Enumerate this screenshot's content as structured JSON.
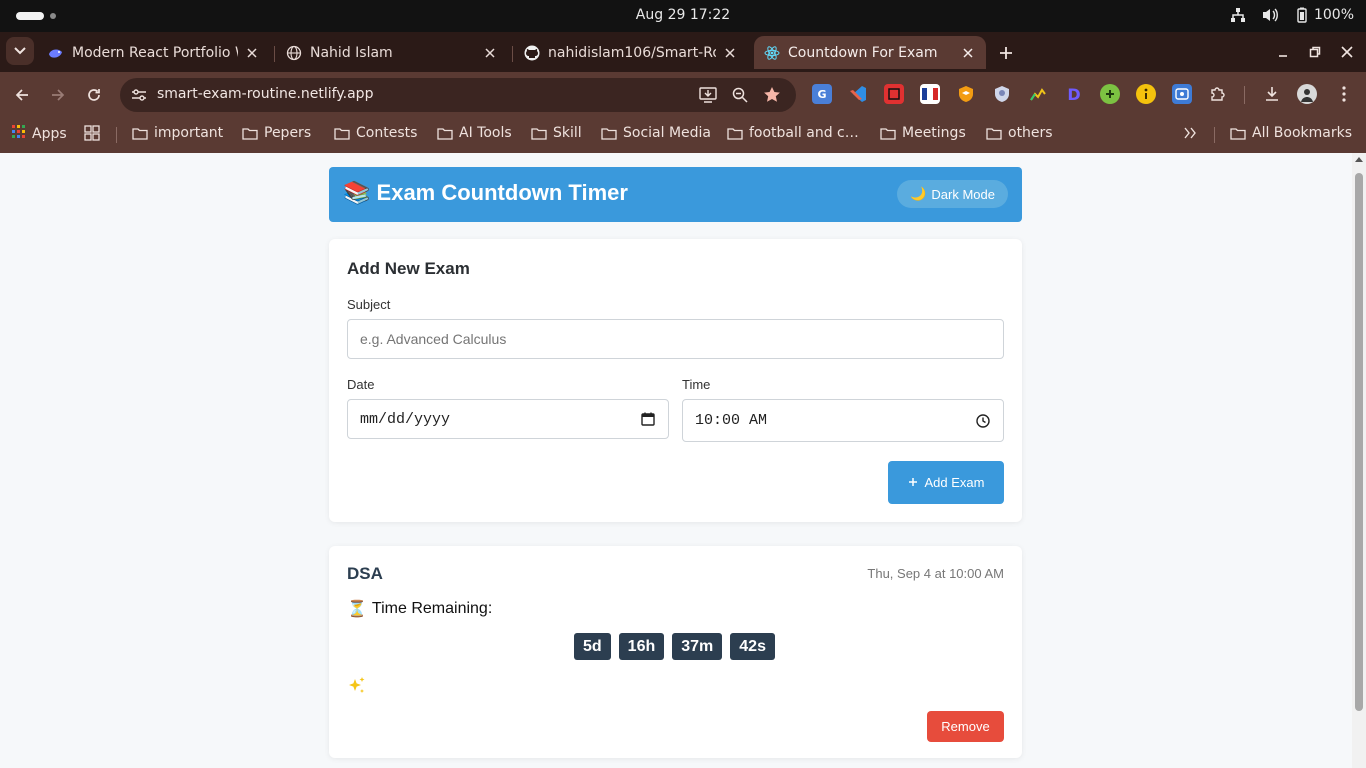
{
  "os": {
    "clock": "Aug 29  17:22",
    "battery": "100%"
  },
  "tabs": [
    {
      "title": "Modern React Portfolio W",
      "icon": "deepseek-whale-icon"
    },
    {
      "title": "Nahid Islam",
      "icon": "globe-icon"
    },
    {
      "title": "nahidislam106/Smart-Ro",
      "icon": "github-icon"
    },
    {
      "title": "Countdown For Exam",
      "icon": "react-icon",
      "active": true
    }
  ],
  "toolbar": {
    "url": "smart-exam-routine.netlify.app"
  },
  "bookmarks": {
    "apps": "Apps",
    "items": [
      "important",
      "Pepers",
      "Contests",
      "AI Tools",
      "Skill",
      "Social Media",
      "football and c…",
      "Meetings",
      "others"
    ],
    "all": "All Bookmarks"
  },
  "app": {
    "title": "Exam Countdown Timer",
    "dark_mode": "Dark Mode",
    "form": {
      "heading": "Add New Exam",
      "subject_label": "Subject",
      "subject_placeholder": "e.g. Advanced Calculus",
      "date_label": "Date",
      "date_value": "mm/dd/yyyy",
      "time_label": "Time",
      "time_value": "10:00 AM",
      "add_button": "Add Exam"
    },
    "exam": {
      "name": "DSA",
      "date": "Thu, Sep 4 at 10:00 AM",
      "remaining_label": "Time Remaining:",
      "days": "5d",
      "hours": "16h",
      "minutes": "37m",
      "seconds": "42s",
      "remove_button": "Remove"
    }
  },
  "colors": {
    "accent": "#3a99dc",
    "chip": "#2c3e50",
    "danger": "#e74c3c",
    "browser_frame": "#5a3a33"
  }
}
